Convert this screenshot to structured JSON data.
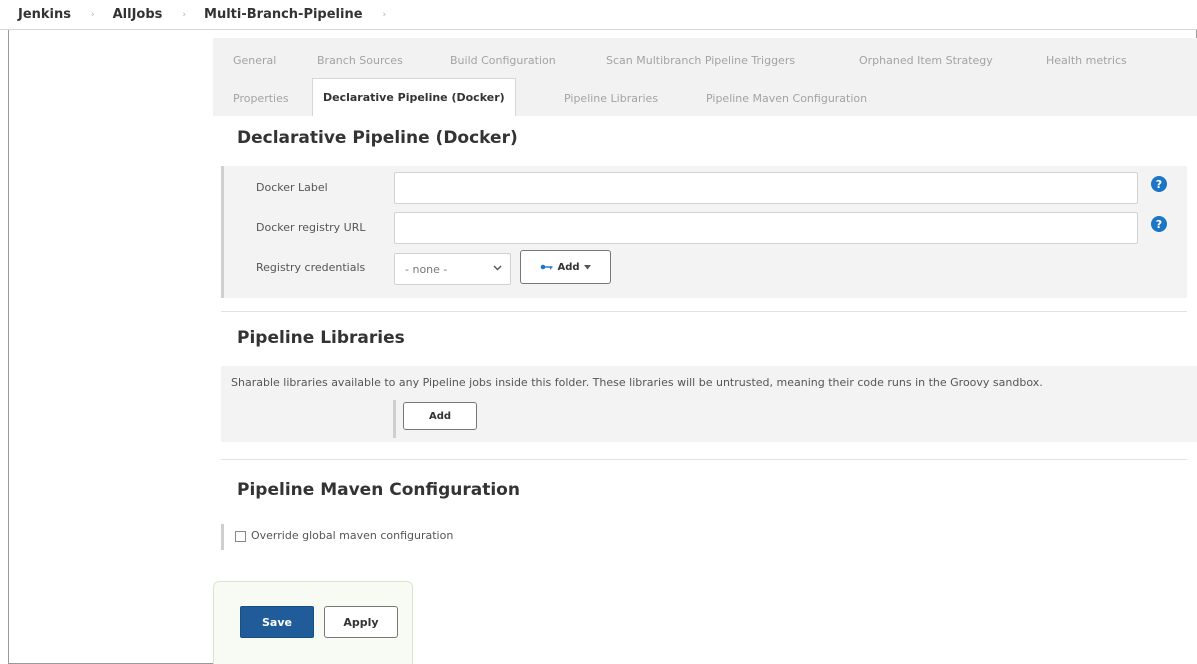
{
  "breadcrumb": {
    "items": [
      "Jenkins",
      "AllJobs",
      "Multi-Branch-Pipeline"
    ],
    "separator": "›"
  },
  "tabs": {
    "row1": [
      "General",
      "Branch Sources",
      "Build Configuration",
      "Scan Multibranch Pipeline Triggers",
      "Orphaned Item Strategy",
      "Health metrics"
    ],
    "row2": [
      "Properties",
      "Declarative Pipeline (Docker)",
      "Pipeline Libraries",
      "Pipeline Maven Configuration"
    ],
    "active": "Declarative Pipeline (Docker)"
  },
  "docker": {
    "title": "Declarative Pipeline (Docker)",
    "label_field": {
      "label": "Docker Label",
      "value": ""
    },
    "registry_url_field": {
      "label": "Docker registry URL",
      "value": ""
    },
    "credentials": {
      "label": "Registry credentials",
      "selected": "- none -",
      "add_label": "Add"
    },
    "help_glyph": "?"
  },
  "libraries": {
    "title": "Pipeline Libraries",
    "description": "Sharable libraries available to any Pipeline jobs inside this folder. These libraries will be untrusted, meaning their code runs in the Groovy sandbox.",
    "add_label": "Add"
  },
  "maven": {
    "title": "Pipeline Maven Configuration",
    "override_label": "Override global maven configuration",
    "override_checked": false
  },
  "actions": {
    "save_label": "Save",
    "apply_label": "Apply"
  },
  "icons": {
    "help": "help-icon",
    "key": "key-icon",
    "caret": "caret-down-icon",
    "chevron": "chevron-down-icon"
  },
  "colors": {
    "primary": "#1f5c99",
    "help": "#1c75c5",
    "tab_inactive": "#a3a3a3"
  }
}
